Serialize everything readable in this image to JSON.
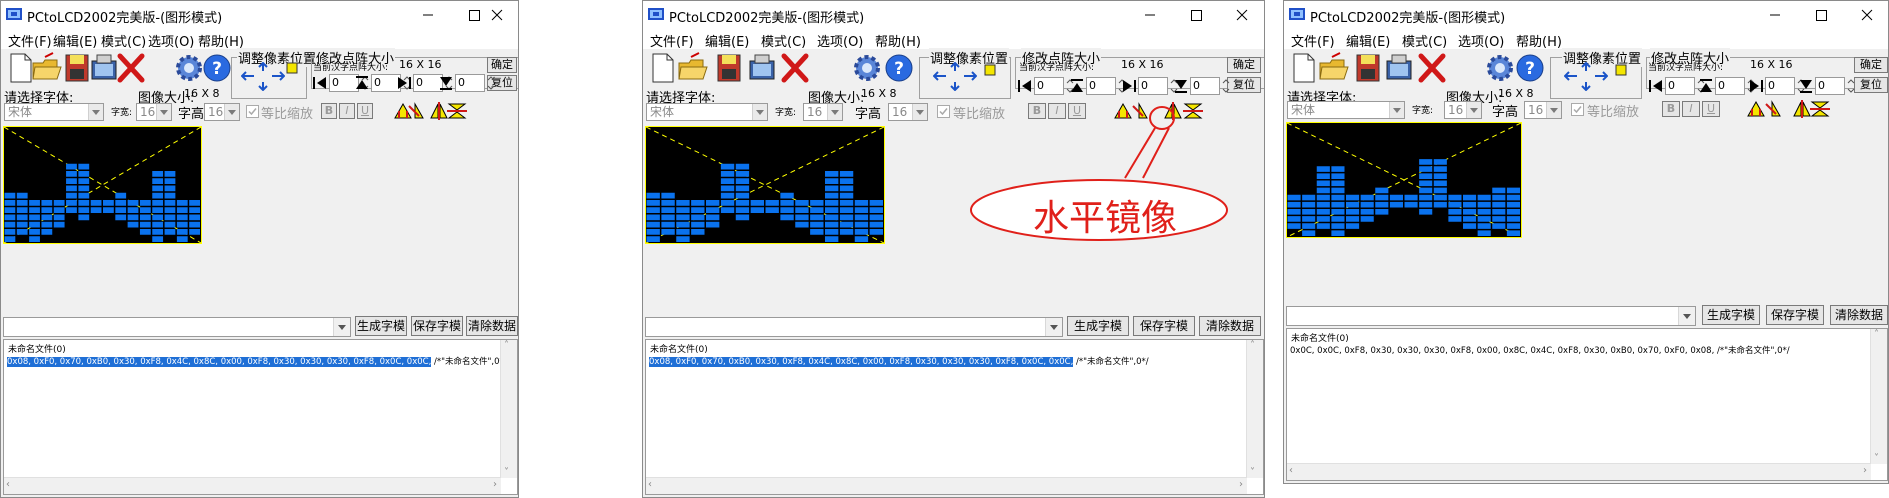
{
  "windows": [
    {
      "title": "PCtoLCD2002完美版-(图形模式)",
      "output_line": "0x08, 0xF0, 0x70, 0xB0, 0x30, 0xF8, 0x4C, 0x8C, 0x00, 0xF8, 0x30, 0x30, 0x30, 0xF8, 0x0C, 0x0C,",
      "output_comment": "/*\"未命名文件\",0*/",
      "output_selected": true
    },
    {
      "title": "PCtoLCD2002完美版-(图形模式)",
      "output_line": "0x08, 0xF0, 0x70, 0xB0, 0x30, 0xF8, 0x4C, 0x8C, 0x00, 0xF8, 0x30, 0x30, 0x30, 0xF8, 0x0C, 0x0C,",
      "output_comment": "/*\"未命名文件\",0*/",
      "output_selected": true
    },
    {
      "title": "PCtoLCD2002完美版-(图形模式)",
      "output_line": "0x0C, 0x0C, 0xF8, 0x30, 0x30, 0x30, 0xF8, 0x00, 0x8C, 0x4C, 0xF8, 0x30, 0xB0, 0x70, 0xF0, 0x08,",
      "output_comment": "/*\"未命名文件\",0*/",
      "output_selected": false
    }
  ],
  "menu": [
    "文件(F)",
    "编辑(E)",
    "模式(C)",
    "选项(O)",
    "帮助(H)"
  ],
  "pixel_group": {
    "title": "调整像素位置"
  },
  "resize_group": {
    "title": "修改点阵大小",
    "sub_label": "当前汉字点阵大小:",
    "size_value": "16 X 16",
    "confirm": "确定",
    "restore": "复位",
    "spin_values": [
      "0",
      "0",
      "0",
      "0"
    ]
  },
  "font": {
    "select_label": "请选择字体:",
    "font_value": "宋体",
    "image_size_label": "图像大小:",
    "image_size_value": "16 X 8",
    "width_label": "字宽:",
    "width_value": "16",
    "height_label": "字高",
    "height_value": "16",
    "ratio_label": "等比缩放",
    "style_buttons": [
      "B",
      "I",
      "U"
    ]
  },
  "actions": {
    "generate": "生成字模",
    "save": "保存字模",
    "clear": "清除数据"
  },
  "output_header": "未命名文件(0)",
  "callout": {
    "text": "水平镜像",
    "color": "#e0201a"
  },
  "colors": {
    "pixel": "#0a72ee",
    "grid_bg": "#000000",
    "grid_border": "#ffff00",
    "selection": "#1f6fd6"
  },
  "bitmap_original": [
    "0000011000000000",
    "0000011000001100",
    "0000011000001100",
    "0000011000001100",
    "1100011001001100",
    "1111111111111111",
    "1111111111111111",
    "1111101001111111",
    "1111100000111111",
    "1111000000011111",
    "1010000000001010"
  ],
  "bitmap_mirrored": [
    "0000000001100000",
    "0011000001100000",
    "0011000001100000",
    "0011000001100000",
    "0011001001100011",
    "1111111111111111",
    "1111111111111111",
    "1111111001011111",
    "1111110000011111",
    "1111100000001111",
    "0101000000000101"
  ]
}
